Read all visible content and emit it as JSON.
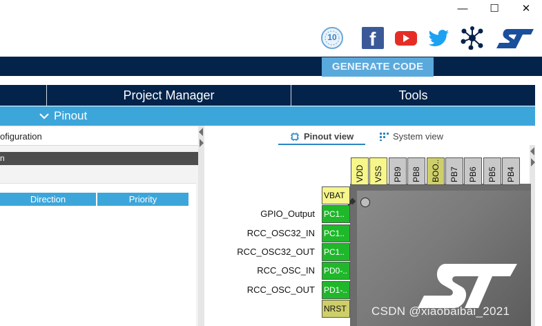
{
  "window_controls": {
    "minimize": "—",
    "maximize": "☐",
    "close": "✕"
  },
  "social": {
    "badge_text": "10",
    "facebook": "f",
    "icons": [
      "anniversary-badge-icon",
      "facebook-icon",
      "youtube-icon",
      "twitter-icon",
      "network-icon",
      "st-logo-icon"
    ]
  },
  "toolbar": {
    "generate_label": "GENERATE CODE"
  },
  "tabs": [
    {
      "label": "Project Manager"
    },
    {
      "label": "Tools"
    }
  ],
  "pinout_bar": {
    "label": "Pinout"
  },
  "left_panel": {
    "config_title": "ofiguration",
    "section_bar": "n",
    "columns": [
      "Direction",
      "Priority"
    ]
  },
  "view_tabs": {
    "pinout": "Pinout view",
    "system": "System view"
  },
  "top_pins": [
    {
      "label": "VDD",
      "color": "#f6f68a"
    },
    {
      "label": "VSS",
      "color": "#f6f68a"
    },
    {
      "label": "PB9",
      "color": "#c8c8c8"
    },
    {
      "label": "PB8",
      "color": "#c8c8c8"
    },
    {
      "label": "BOO..",
      "color": "#cfcf6a"
    },
    {
      "label": "PB7",
      "color": "#c8c8c8"
    },
    {
      "label": "PB6",
      "color": "#c8c8c8"
    },
    {
      "label": "PB5",
      "color": "#c8c8c8"
    },
    {
      "label": "PB4",
      "color": "#c8c8c8"
    }
  ],
  "left_pins": [
    {
      "label": "VBAT",
      "signal": "",
      "type": "yellow"
    },
    {
      "label": "PC1..",
      "signal": "GPIO_Output",
      "type": "green"
    },
    {
      "label": "PC1..",
      "signal": "RCC_OSC32_IN",
      "type": "green"
    },
    {
      "label": "PC1..",
      "signal": "RCC_OSC32_OUT",
      "type": "green"
    },
    {
      "label": "PD0-..",
      "signal": "RCC_OSC_IN",
      "type": "green"
    },
    {
      "label": "PD1-..",
      "signal": "RCC_OSC_OUT",
      "type": "green"
    },
    {
      "label": "NRST",
      "signal": "",
      "type": "olive"
    }
  ],
  "watermark": "CSDN @xiaobaibai_2021",
  "colors": {
    "navy": "#03234b",
    "accent_blue": "#3ca6db",
    "generate_button": "#5aa9dc",
    "pin_green": "#1fb82a",
    "pin_yellow": "#f6f68a"
  }
}
